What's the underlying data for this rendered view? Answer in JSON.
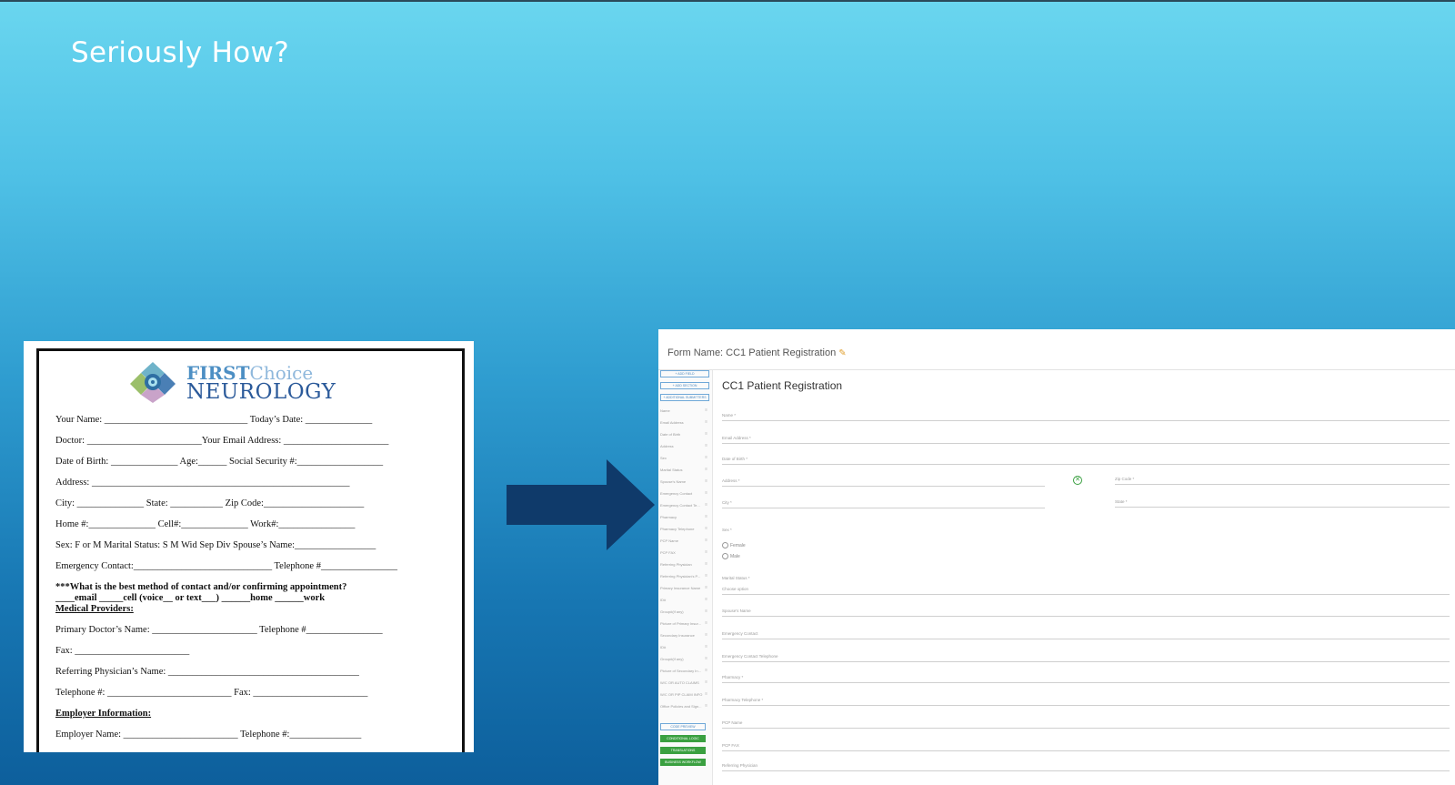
{
  "slide": {
    "title": "Seriously How?"
  },
  "paper_form": {
    "logo": {
      "first": "FIRST",
      "choice": "Choice",
      "neurology": "NEUROLOGY"
    },
    "lines": [
      {
        "text": "Your Name: ______________________________ Today’s Date: ______________",
        "style": ""
      },
      {
        "text": "Doctor: ________________________Your Email Address: ______________________",
        "style": ""
      },
      {
        "text": "Date of Birth: ______________  Age:______  Social Security #:__________________",
        "style": ""
      },
      {
        "text": "Address: ______________________________________________________",
        "style": ""
      },
      {
        "text": "City: ______________ State: ___________ Zip Code:_____________________",
        "style": ""
      },
      {
        "text": "Home #:______________ Cell#:______________ Work#:________________",
        "style": ""
      },
      {
        "text": "Sex:  F or M   Marital Status: S M Wid Sep Div    Spouse’s Name:_________________",
        "style": ""
      },
      {
        "text": "Emergency Contact:_____________________________ Telephone #________________",
        "style": ""
      },
      {
        "text": "***What is the best method of contact and/or confirming appointment?",
        "style": "bold"
      },
      {
        "text": "____email _____cell (voice__ or text___) ______home ______work",
        "style": "bold"
      },
      {
        "text": "Medical Providers:",
        "style": "under"
      },
      {
        "text": "Primary Doctor’s Name: ______________________ Telephone #________________",
        "style": ""
      },
      {
        "text": "Fax: ________________________",
        "style": ""
      },
      {
        "text": "Referring Physician’s Name: ________________________________________",
        "style": ""
      },
      {
        "text": "Telephone #: __________________________ Fax: ________________________",
        "style": ""
      },
      {
        "text": "Employer Information:",
        "style": "under"
      },
      {
        "text": "Employer Name: ________________________ Telephone #:_______________",
        "style": ""
      }
    ]
  },
  "web_form": {
    "header": "Form Name: CC1 Patient Registration",
    "title": "CC1 Patient Registration",
    "sidebar_buttons": [
      "+ ADD FIELD",
      "+ ADD SECTION",
      "+ ADDITIONAL SUBMITTERS"
    ],
    "sidebar_items": [
      "Name",
      "Email Address",
      "Date of Birth",
      "Address",
      "Sex",
      "Marital Status",
      "Spouse's Name",
      "Emergency Contact",
      "Emergency Contact Te...",
      "Pharmacy",
      "Pharmacy Telephone",
      "PCP Name",
      "PCP FAX",
      "Referring Physician",
      "Referring Physician's P...",
      "Primary Insurance Name",
      "ID#",
      "Group#(if any)",
      "Picture of Primary Insur...",
      "Secondary Insurance",
      "ID#",
      "Group#(if any)",
      "Picture of Secondary In...",
      "W/C OR AUTO CLAIMS",
      "W/C OR PIP CLAIM INFO",
      "Office Policies and Sign..."
    ],
    "sidebar_bottom": [
      "CODE PREVIEW",
      "CONDITIONAL LOGIC",
      "TRANSLATIONS",
      "BUSINESS WORKFLOW"
    ],
    "fields": {
      "name": "Name *",
      "email": "Email Address *",
      "dob": "Date of Birth *",
      "address": "Address *",
      "zip": "Zip Code *",
      "city": "City *",
      "state": "State *",
      "sex": "Sex *",
      "female": "Female",
      "male": "Male",
      "marital": "Marital Status *",
      "marital_select": "Choose option",
      "spouse": "Spouse's Name",
      "emergency": "Emergency Contact",
      "emergency_tel": "Emergency Contact Telephone",
      "pharmacy": "Pharmacy *",
      "pharmacy_tel": "Pharmacy Telephone *",
      "pcp_name": "PCP Name",
      "pcp_fax": "PCP FAX",
      "referring": "Referring Physician"
    }
  }
}
